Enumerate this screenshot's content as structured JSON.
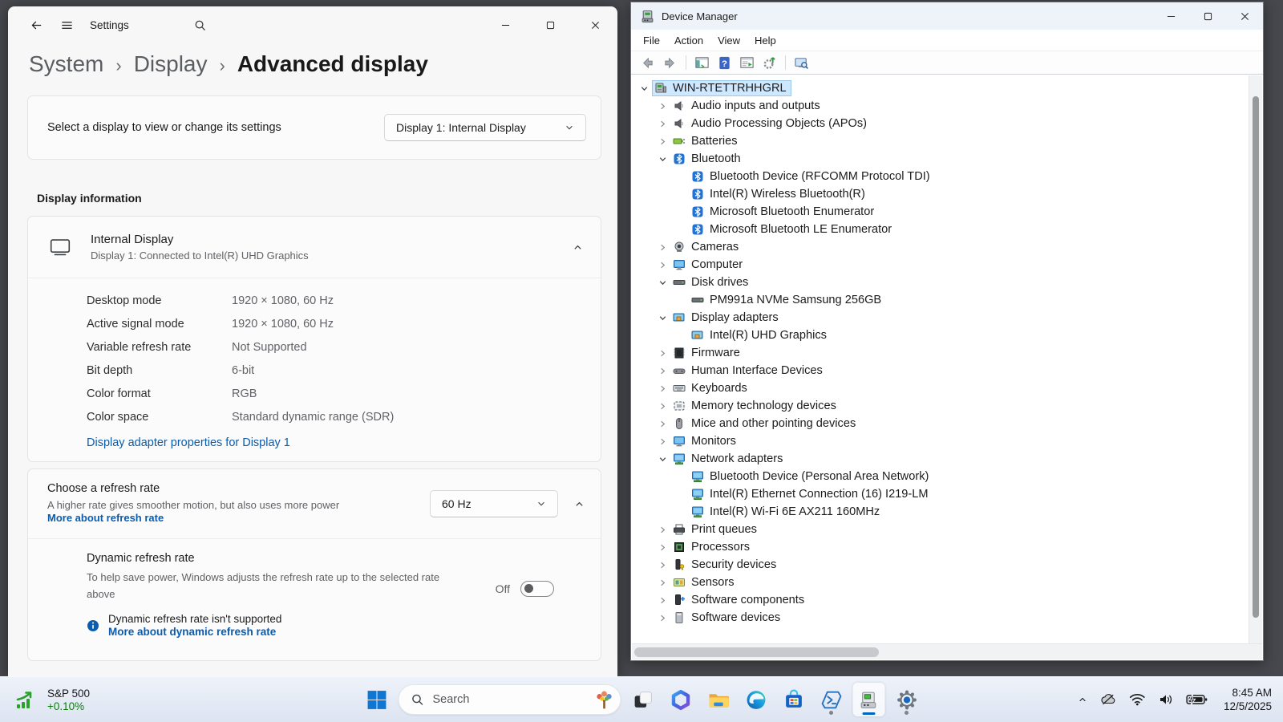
{
  "colors": {
    "accent": "#0067c0",
    "link_blue": "#0b5cad",
    "stock_green": "#0f7b10",
    "selection_blue": "#cde8ff"
  },
  "settings_window": {
    "titlebar": {
      "title": "Settings"
    },
    "breadcrumb": [
      "System",
      "Display",
      "Advanced display"
    ],
    "display_selector": {
      "label": "Select a display to view or change its settings",
      "value": "Display 1: Internal Display"
    },
    "section_title": "Display information",
    "display_info": {
      "title": "Internal Display",
      "subtitle": "Display 1: Connected to Intel(R) UHD Graphics",
      "rows": [
        {
          "label": "Desktop mode",
          "value": "1920 × 1080, 60 Hz"
        },
        {
          "label": "Active signal mode",
          "value": "1920 × 1080, 60 Hz"
        },
        {
          "label": "Variable refresh rate",
          "value": "Not Supported"
        },
        {
          "label": "Bit depth",
          "value": "6-bit"
        },
        {
          "label": "Color format",
          "value": "RGB"
        },
        {
          "label": "Color space",
          "value": "Standard dynamic range (SDR)"
        }
      ],
      "link": "Display adapter properties for Display 1"
    },
    "refresh_rate": {
      "title": "Choose a refresh rate",
      "description": "A higher rate gives smoother motion, but also uses more power",
      "link": "More about refresh rate",
      "value": "60 Hz"
    },
    "dynamic_refresh": {
      "title": "Dynamic refresh rate",
      "description": "To help save power, Windows adjusts the refresh rate up to the selected rate above",
      "toggle_label": "Off",
      "info": "Dynamic refresh rate isn't supported",
      "link": "More about dynamic refresh rate"
    }
  },
  "device_manager": {
    "titlebar": {
      "title": "Device Manager"
    },
    "menus": [
      "File",
      "Action",
      "View",
      "Help"
    ],
    "toolbar": [
      "nav-back",
      "nav-forward",
      "separator",
      "console-tree",
      "help",
      "export-list",
      "scan-hardware",
      "separator",
      "remote-computer"
    ],
    "tree": [
      {
        "label": "WIN-RTETTRHHGRL",
        "level": 0,
        "state": "expanded",
        "icon": "computer-host",
        "selected": true
      },
      {
        "label": "Audio inputs and outputs",
        "level": 1,
        "state": "collapsed",
        "icon": "audio-device"
      },
      {
        "label": "Audio Processing Objects (APOs)",
        "level": 1,
        "state": "collapsed",
        "icon": "audio-device"
      },
      {
        "label": "Batteries",
        "level": 1,
        "state": "collapsed",
        "icon": "battery-device"
      },
      {
        "label": "Bluetooth",
        "level": 1,
        "state": "expanded",
        "icon": "bluetooth-device"
      },
      {
        "label": "Bluetooth Device (RFCOMM Protocol TDI)",
        "level": 2,
        "state": "leaf",
        "icon": "bluetooth-device"
      },
      {
        "label": "Intel(R) Wireless Bluetooth(R)",
        "level": 2,
        "state": "leaf",
        "icon": "bluetooth-device"
      },
      {
        "label": "Microsoft Bluetooth Enumerator",
        "level": 2,
        "state": "leaf",
        "icon": "bluetooth-device"
      },
      {
        "label": "Microsoft Bluetooth LE Enumerator",
        "level": 2,
        "state": "leaf",
        "icon": "bluetooth-device"
      },
      {
        "label": "Cameras",
        "level": 1,
        "state": "collapsed",
        "icon": "camera-device"
      },
      {
        "label": "Computer",
        "level": 1,
        "state": "collapsed",
        "icon": "computer-device"
      },
      {
        "label": "Disk drives",
        "level": 1,
        "state": "expanded",
        "icon": "disk-device"
      },
      {
        "label": "PM991a NVMe Samsung 256GB",
        "level": 2,
        "state": "leaf",
        "icon": "disk-device"
      },
      {
        "label": "Display adapters",
        "level": 1,
        "state": "expanded",
        "icon": "display-adapter-device"
      },
      {
        "label": "Intel(R) UHD Graphics",
        "level": 2,
        "state": "leaf",
        "icon": "display-adapter-device"
      },
      {
        "label": "Firmware",
        "level": 1,
        "state": "collapsed",
        "icon": "firmware-device"
      },
      {
        "label": "Human Interface Devices",
        "level": 1,
        "state": "collapsed",
        "icon": "hid-device"
      },
      {
        "label": "Keyboards",
        "level": 1,
        "state": "collapsed",
        "icon": "keyboard-device"
      },
      {
        "label": "Memory technology devices",
        "level": 1,
        "state": "collapsed",
        "icon": "memory-device"
      },
      {
        "label": "Mice and other pointing devices",
        "level": 1,
        "state": "collapsed",
        "icon": "mouse-device"
      },
      {
        "label": "Monitors",
        "level": 1,
        "state": "collapsed",
        "icon": "monitor-device"
      },
      {
        "label": "Network adapters",
        "level": 1,
        "state": "expanded",
        "icon": "network-device"
      },
      {
        "label": "Bluetooth Device (Personal Area Network)",
        "level": 2,
        "state": "leaf",
        "icon": "network-device"
      },
      {
        "label": "Intel(R) Ethernet Connection (16) I219-LM",
        "level": 2,
        "state": "leaf",
        "icon": "network-device"
      },
      {
        "label": "Intel(R) Wi-Fi 6E AX211 160MHz",
        "level": 2,
        "state": "leaf",
        "icon": "network-device"
      },
      {
        "label": "Print queues",
        "level": 1,
        "state": "collapsed",
        "icon": "printer-device"
      },
      {
        "label": "Processors",
        "level": 1,
        "state": "collapsed",
        "icon": "processor-device"
      },
      {
        "label": "Security devices",
        "level": 1,
        "state": "collapsed",
        "icon": "security-device"
      },
      {
        "label": "Sensors",
        "level": 1,
        "state": "collapsed",
        "icon": "sensor-device"
      },
      {
        "label": "Software components",
        "level": 1,
        "state": "collapsed",
        "icon": "software-component-device"
      },
      {
        "label": "Software devices",
        "level": 1,
        "state": "collapsed",
        "icon": "software-device"
      }
    ]
  },
  "taskbar": {
    "widget": {
      "title": "S&P 500",
      "change": "+0.10%"
    },
    "search": {
      "placeholder": "Search"
    },
    "apps": [
      {
        "name": "task-view"
      },
      {
        "name": "copilot"
      },
      {
        "name": "file-explorer"
      },
      {
        "name": "edge"
      },
      {
        "name": "microsoft-store"
      },
      {
        "name": "powershell",
        "running": true
      },
      {
        "name": "device-manager",
        "running": true,
        "active": true
      },
      {
        "name": "settings",
        "running": true
      }
    ],
    "tray": {
      "icons": [
        "chevron-up",
        "cloud-offline",
        "wifi",
        "volume",
        "battery-charging"
      ],
      "time": "8:45 AM",
      "date": "12/5/2025"
    }
  }
}
